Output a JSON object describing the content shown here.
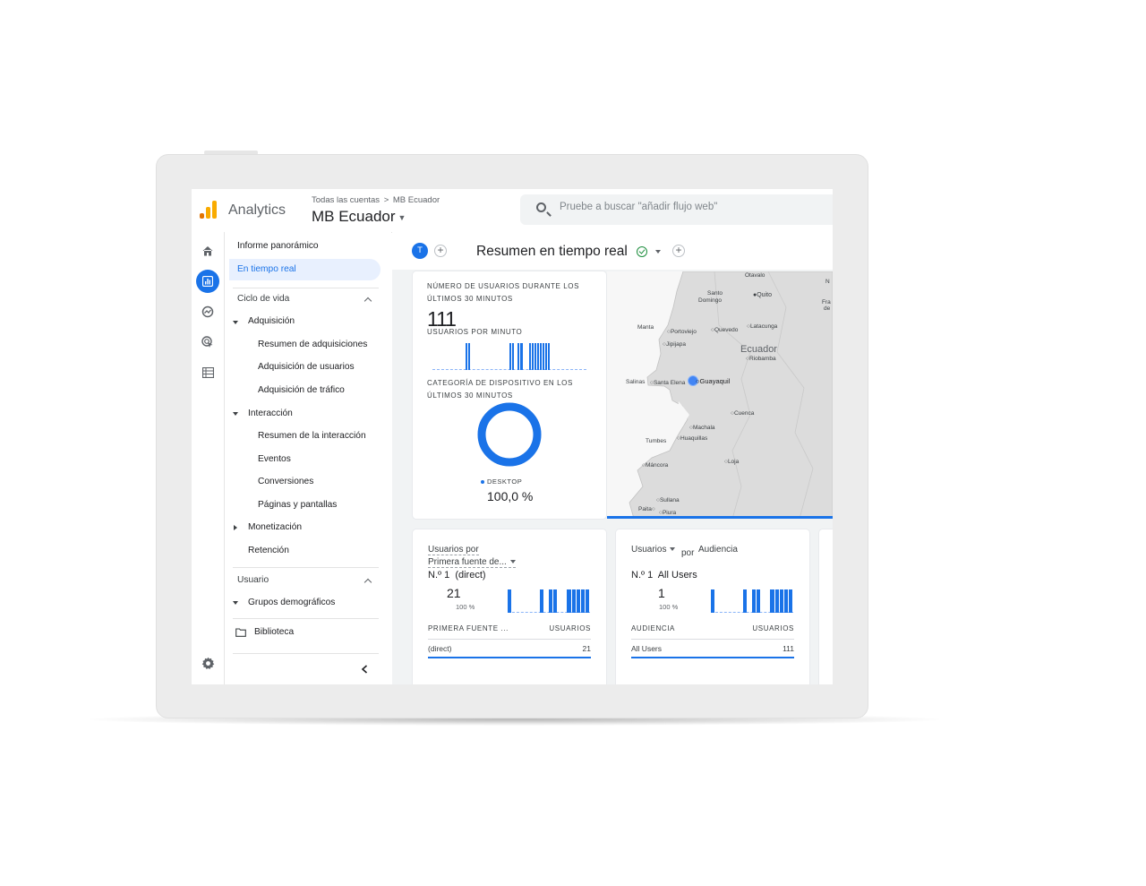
{
  "colors": {
    "accent": "#1a73e8",
    "success": "#1e8e3e",
    "logo_orange": "#f9ab00",
    "logo_dark_orange": "#e37400"
  },
  "header": {
    "app_name": "Analytics",
    "breadcrumb_root": "Todas las cuentas",
    "breadcrumb_sep": ">",
    "breadcrumb_account": "MB Ecuador",
    "account_name": "MB Ecuador",
    "search_placeholder": "Pruebe a buscar \"añadir flujo web\""
  },
  "rail": {
    "icons": [
      "home-icon",
      "reports-icon",
      "explore-icon",
      "advertising-icon",
      "configure-icon",
      "gear-icon"
    ]
  },
  "nav": {
    "overview": "Informe panorámico",
    "realtime": "En tiempo real",
    "lifecycle": "Ciclo de vida",
    "acquisition": "Adquisición",
    "acq_overview": "Resumen de adquisiciones",
    "user_acq": "Adquisición de usuarios",
    "traffic_acq": "Adquisición de tráfico",
    "engagement": "Interacción",
    "eng_overview": "Resumen de la interacción",
    "events": "Eventos",
    "conversions": "Conversiones",
    "pages": "Páginas y pantallas",
    "monetization": "Monetización",
    "retention": "Retención",
    "user": "Usuario",
    "demographics": "Grupos demográficos",
    "library": "Biblioteca"
  },
  "realtime": {
    "avatar_letter": "T",
    "title": "Resumen en tiempo real",
    "users_caption_1": "Número de usuarios durante los",
    "users_caption_2": "últimos 30 minutos",
    "users_value": "111",
    "per_minute_caption": "Usuarios por minuto",
    "per_minute_bars": [
      0,
      0,
      0,
      0,
      0,
      0,
      0,
      0,
      0,
      0,
      0,
      0,
      1,
      1,
      0,
      0,
      0,
      0,
      0,
      0,
      0,
      0,
      0,
      0,
      0,
      0,
      0,
      0,
      1,
      1,
      0,
      1,
      1,
      0,
      0,
      1,
      1,
      1,
      1,
      1,
      1,
      1,
      1,
      0,
      0,
      0,
      0,
      0,
      0,
      0,
      0,
      0,
      0,
      0,
      0,
      0
    ],
    "device_caption_1": "Categoría de dispositivo en los",
    "device_caption_2": "últimos 30 minutos",
    "device_legend": "DESKTOP",
    "device_value": "100,0 %",
    "device_share": 1.0
  },
  "map": {
    "country": "Ecuador",
    "cities": [
      "Otavalo",
      "Santo",
      "Domingo",
      "Quito",
      "Manta",
      "Portoviejo",
      "Quevedo",
      "Latacunga",
      "Jipijapa",
      "Riobamba",
      "Salinas",
      "Santa Elena",
      "Guayaquil",
      "Cuenca",
      "Machala",
      "Tumbes",
      "Huaquillas",
      "Máncora",
      "Loja",
      "Sullana",
      "Paita",
      "Piura",
      "Fra",
      "de",
      "N"
    ]
  },
  "source_card": {
    "title_1": "Usuarios por",
    "title_2": "Primera fuente de...",
    "rank": "N.º 1",
    "top_item": "(direct)",
    "value": "21",
    "percent": "100 %",
    "bars": [
      1,
      0,
      0,
      0,
      0,
      0,
      0,
      1,
      0,
      1,
      1,
      0,
      0,
      1,
      1,
      1,
      1,
      1
    ],
    "col1": "PRIMERA FUENTE ...",
    "col2": "USUARIOS",
    "row_label": "(direct)",
    "row_value": "21"
  },
  "audience_card": {
    "title_1": "Usuarios",
    "title_por": "por",
    "title_2": "Audiencia",
    "rank": "N.º 1",
    "top_item": "All Users",
    "value": "1",
    "percent": "100 %",
    "bars": [
      1,
      0,
      0,
      0,
      0,
      0,
      0,
      1,
      0,
      1,
      1,
      0,
      0,
      1,
      1,
      1,
      1,
      1
    ],
    "col1": "AUDIENCIA",
    "col2": "USUARIOS",
    "row_label": "All Users",
    "row_value": "111"
  }
}
